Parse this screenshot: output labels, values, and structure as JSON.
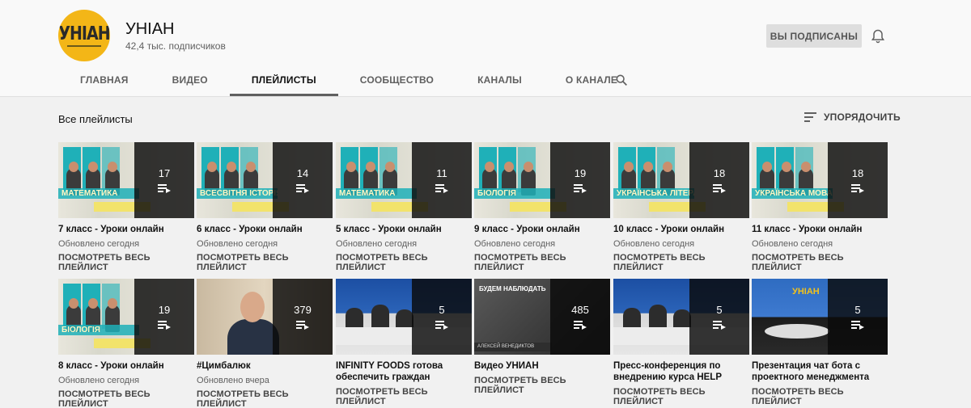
{
  "channel": {
    "logo_text": "УНІАН",
    "name": "УНІАН",
    "subscribers": "42,4 тыс. подписчиков",
    "subscribed_label": "ВЫ ПОДПИСАНЫ"
  },
  "tabs": [
    "ГЛАВНАЯ",
    "ВИДЕО",
    "ПЛЕЙЛИСТЫ",
    "СООБЩЕСТВО",
    "КАНАЛЫ",
    "О КАНАЛЕ"
  ],
  "active_tab": "ПЛЕЙЛИСТЫ",
  "section": {
    "title": "Все плейлисты",
    "sort_label": "УПОРЯДОЧИТЬ"
  },
  "playlists": [
    {
      "title": "7 класс - Уроки онлайн",
      "updated": "Обновлено сегодня",
      "count": "17",
      "link": "ПОСМОТРЕТЬ ВЕСЬ ПЛЕЙЛИСТ",
      "thumb": "education",
      "band": "МАТЕМАТИКА"
    },
    {
      "title": "6 класс - Уроки онлайн",
      "updated": "Обновлено сегодня",
      "count": "14",
      "link": "ПОСМОТРЕТЬ ВЕСЬ ПЛЕЙЛИСТ",
      "thumb": "education",
      "band": "ВСЕСВІТНЯ ІСТОРІЯ"
    },
    {
      "title": "5 класс - Уроки онлайн",
      "updated": "Обновлено сегодня",
      "count": "11",
      "link": "ПОСМОТРЕТЬ ВЕСЬ ПЛЕЙЛИСТ",
      "thumb": "education",
      "band": "МАТЕМАТИКА"
    },
    {
      "title": "9 класс - Уроки онлайн",
      "updated": "Обновлено сегодня",
      "count": "19",
      "link": "ПОСМОТРЕТЬ ВЕСЬ ПЛЕЙЛИСТ",
      "thumb": "education",
      "band": "БІОЛОГІЯ"
    },
    {
      "title": "10 класс - Уроки онлайн",
      "updated": "Обновлено сегодня",
      "count": "18",
      "link": "ПОСМОТРЕТЬ ВЕСЬ ПЛЕЙЛИСТ",
      "thumb": "education",
      "band": "УКРАЇНСЬКА ЛІТЕРАТУРА"
    },
    {
      "title": "11 класс - Уроки онлайн",
      "updated": "Обновлено сегодня",
      "count": "18",
      "link": "ПОСМОТРЕТЬ ВЕСЬ ПЛЕЙЛИСТ",
      "thumb": "education",
      "band": "УКРАЇНСЬКА МОВА"
    },
    {
      "title": "8 класс - Уроки онлайн",
      "updated": "Обновлено сегодня",
      "count": "19",
      "link": "ПОСМОТРЕТЬ ВЕСЬ ПЛЕЙЛИСТ",
      "thumb": "education",
      "band": "БІОЛОГІЯ"
    },
    {
      "title": "#Цимбалюк",
      "updated": "Обновлено вчера",
      "count": "379",
      "link": "ПОСМОТРЕТЬ ВЕСЬ ПЛЕЙЛИСТ",
      "thumb": "man"
    },
    {
      "title": "INFINITY FOODS готова обеспечить граждан Украины...",
      "updated": "",
      "count": "5",
      "link": "ПОСМОТРЕТЬ ВЕСЬ ПЛЕЙЛИСТ",
      "thumb": "news"
    },
    {
      "title": "Видео УНИАН",
      "updated": "",
      "count": "485",
      "link": "ПОСМОТРЕТЬ ВЕСЬ ПЛЕЙЛИСТ",
      "thumb": "dark",
      "caption": "БУДЕМ НАБЛЮДАТЬ",
      "strip": "АЛЕКСЕЙ ВЕНЕДИКТОВ"
    },
    {
      "title": "Пресс-конференция по внедрению курса HELP Совет...",
      "updated": "",
      "count": "5",
      "link": "ПОСМОТРЕТЬ ВЕСЬ ПЛЕЙЛИСТ",
      "thumb": "news"
    },
    {
      "title": "Презентация чат бота с проектного менеджмента дл...",
      "updated": "",
      "count": "5",
      "link": "ПОСМОТРЕТЬ ВЕСЬ ПЛЕЙЛИСТ",
      "thumb": "conf",
      "logo": "УНІАН"
    }
  ]
}
